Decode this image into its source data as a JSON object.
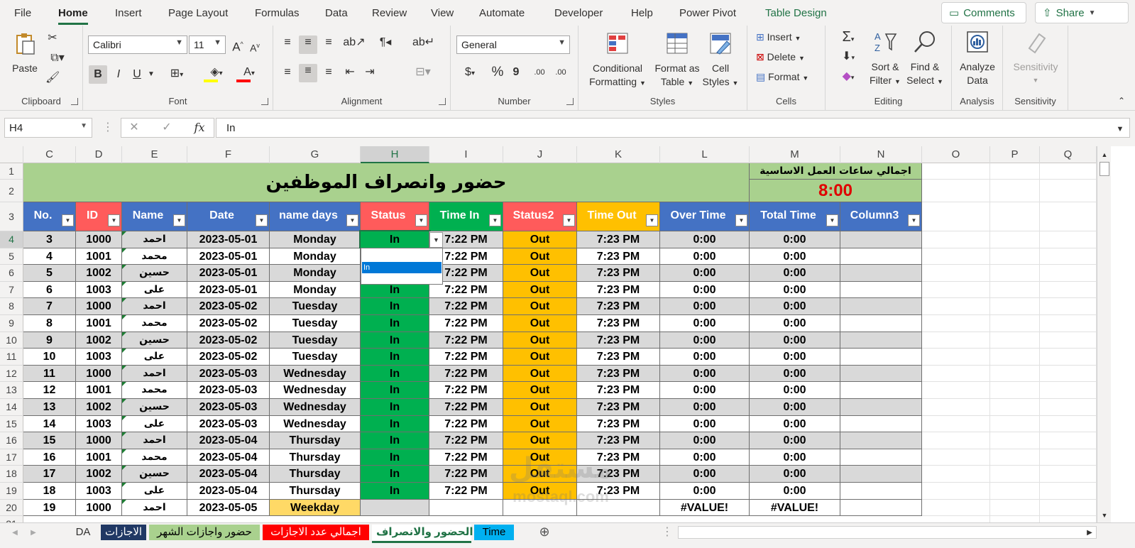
{
  "ribbon_tabs": [
    "File",
    "Home",
    "Insert",
    "Page Layout",
    "Formulas",
    "Data",
    "Review",
    "View",
    "Automate",
    "Developer",
    "Help",
    "Power Pivot",
    "Table Design"
  ],
  "active_tab": "Home",
  "top_buttons": {
    "comments": "Comments",
    "share": "Share"
  },
  "clipboard": {
    "paste": "Paste",
    "label": "Clipboard"
  },
  "font": {
    "family": "Calibri",
    "size": "11",
    "label": "Font",
    "bold": "B",
    "italic": "I",
    "underline": "U",
    "grow": "A",
    "shrink": "A",
    "fill_color": "#ffff00",
    "font_color": "#ff0000"
  },
  "alignment": {
    "label": "Alignment"
  },
  "number": {
    "format": "General",
    "label": "Number",
    "currency": "$",
    "percent": "%",
    "comma": "9"
  },
  "styles": {
    "conditional": [
      "Conditional",
      "Formatting"
    ],
    "format_table": [
      "Format as",
      "Table"
    ],
    "cell_styles": [
      "Cell",
      "Styles"
    ],
    "label": "Styles"
  },
  "cells": {
    "insert": "Insert",
    "delete": "Delete",
    "format": "Format",
    "label": "Cells"
  },
  "editing": {
    "sort": [
      "Sort &",
      "Filter"
    ],
    "find": [
      "Find &",
      "Select"
    ],
    "label": "Editing"
  },
  "analysis": {
    "analyze": [
      "Analyze",
      "Data"
    ],
    "label": "Analysis"
  },
  "sensitivity": {
    "btn": "Sensitivity",
    "label": "Sensitivity"
  },
  "formula_bar": {
    "name_box": "H4",
    "formula": "In",
    "fx": "fx"
  },
  "columns": [
    "C",
    "D",
    "E",
    "F",
    "G",
    "H",
    "I",
    "J",
    "K",
    "L",
    "M",
    "N",
    "O",
    "P",
    "Q"
  ],
  "title_main": "حضور وانصراف الموظفين",
  "hours_label": "اجمالي ساعات العمل الاساسية",
  "hours_value": "8:00",
  "headers": [
    "No.",
    "ID",
    "Name",
    "Date",
    "name days",
    "Status",
    "Time In",
    "Status2",
    "Time Out",
    "Over Time",
    "Total Time",
    "Column3"
  ],
  "rows": [
    {
      "r": "4",
      "no": "3",
      "id": "1000",
      "name": "احمد",
      "date": "2023-05-01",
      "day": "Monday",
      "status": "In",
      "tin": "7:22 PM",
      "status2": "Out",
      "tout": "7:23 PM",
      "ot": "0:00",
      "tt": "0:00"
    },
    {
      "r": "5",
      "no": "4",
      "id": "1001",
      "name": "محمد",
      "date": "2023-05-01",
      "day": "Monday",
      "status": "In",
      "tin": "7:22 PM",
      "status2": "Out",
      "tout": "7:23 PM",
      "ot": "0:00",
      "tt": "0:00"
    },
    {
      "r": "6",
      "no": "5",
      "id": "1002",
      "name": "حسين",
      "date": "2023-05-01",
      "day": "Monday",
      "status": "In",
      "tin": "7:22 PM",
      "status2": "Out",
      "tout": "7:23 PM",
      "ot": "0:00",
      "tt": "0:00"
    },
    {
      "r": "7",
      "no": "6",
      "id": "1003",
      "name": "على",
      "date": "2023-05-01",
      "day": "Monday",
      "status": "In",
      "tin": "7:22 PM",
      "status2": "Out",
      "tout": "7:23 PM",
      "ot": "0:00",
      "tt": "0:00"
    },
    {
      "r": "8",
      "no": "7",
      "id": "1000",
      "name": "احمد",
      "date": "2023-05-02",
      "day": "Tuesday",
      "status": "In",
      "tin": "7:22 PM",
      "status2": "Out",
      "tout": "7:23 PM",
      "ot": "0:00",
      "tt": "0:00"
    },
    {
      "r": "9",
      "no": "8",
      "id": "1001",
      "name": "محمد",
      "date": "2023-05-02",
      "day": "Tuesday",
      "status": "In",
      "tin": "7:22 PM",
      "status2": "Out",
      "tout": "7:23 PM",
      "ot": "0:00",
      "tt": "0:00"
    },
    {
      "r": "10",
      "no": "9",
      "id": "1002",
      "name": "حسين",
      "date": "2023-05-02",
      "day": "Tuesday",
      "status": "In",
      "tin": "7:22 PM",
      "status2": "Out",
      "tout": "7:23 PM",
      "ot": "0:00",
      "tt": "0:00"
    },
    {
      "r": "11",
      "no": "10",
      "id": "1003",
      "name": "على",
      "date": "2023-05-02",
      "day": "Tuesday",
      "status": "In",
      "tin": "7:22 PM",
      "status2": "Out",
      "tout": "7:23 PM",
      "ot": "0:00",
      "tt": "0:00"
    },
    {
      "r": "12",
      "no": "11",
      "id": "1000",
      "name": "احمد",
      "date": "2023-05-03",
      "day": "Wednesday",
      "status": "In",
      "tin": "7:22 PM",
      "status2": "Out",
      "tout": "7:23 PM",
      "ot": "0:00",
      "tt": "0:00"
    },
    {
      "r": "13",
      "no": "12",
      "id": "1001",
      "name": "محمد",
      "date": "2023-05-03",
      "day": "Wednesday",
      "status": "In",
      "tin": "7:22 PM",
      "status2": "Out",
      "tout": "7:23 PM",
      "ot": "0:00",
      "tt": "0:00"
    },
    {
      "r": "14",
      "no": "13",
      "id": "1002",
      "name": "حسين",
      "date": "2023-05-03",
      "day": "Wednesday",
      "status": "In",
      "tin": "7:22 PM",
      "status2": "Out",
      "tout": "7:23 PM",
      "ot": "0:00",
      "tt": "0:00"
    },
    {
      "r": "15",
      "no": "14",
      "id": "1003",
      "name": "على",
      "date": "2023-05-03",
      "day": "Wednesday",
      "status": "In",
      "tin": "7:22 PM",
      "status2": "Out",
      "tout": "7:23 PM",
      "ot": "0:00",
      "tt": "0:00"
    },
    {
      "r": "16",
      "no": "15",
      "id": "1000",
      "name": "احمد",
      "date": "2023-05-04",
      "day": "Thursday",
      "status": "In",
      "tin": "7:22 PM",
      "status2": "Out",
      "tout": "7:23 PM",
      "ot": "0:00",
      "tt": "0:00"
    },
    {
      "r": "17",
      "no": "16",
      "id": "1001",
      "name": "محمد",
      "date": "2023-05-04",
      "day": "Thursday",
      "status": "In",
      "tin": "7:22 PM",
      "status2": "Out",
      "tout": "7:23 PM",
      "ot": "0:00",
      "tt": "0:00"
    },
    {
      "r": "18",
      "no": "17",
      "id": "1002",
      "name": "حسين",
      "date": "2023-05-04",
      "day": "Thursday",
      "status": "In",
      "tin": "7:22 PM",
      "status2": "Out",
      "tout": "7:23 PM",
      "ot": "0:00",
      "tt": "0:00"
    },
    {
      "r": "19",
      "no": "18",
      "id": "1003",
      "name": "على",
      "date": "2023-05-04",
      "day": "Thursday",
      "status": "In",
      "tin": "7:22 PM",
      "status2": "Out",
      "tout": "7:23 PM",
      "ot": "0:00",
      "tt": "0:00"
    },
    {
      "r": "20",
      "no": "19",
      "id": "1000",
      "name": "احمد",
      "date": "2023-05-05",
      "day": "Weekday",
      "status": "",
      "tin": "",
      "status2": "",
      "tout": "",
      "ot": "#VALUE!",
      "tt": "#VALUE!"
    }
  ],
  "dropdown_option": "In",
  "sheet_tabs": [
    {
      "name": "DA",
      "color": "#f3f2f1",
      "text": "#323130"
    },
    {
      "name": "الاجازات",
      "color": "#203864",
      "text": "#ffffff"
    },
    {
      "name": "حضور واجازات الشهر",
      "color": "#a9d18e",
      "text": "#000000"
    },
    {
      "name": "اجمالي عدد الاجازات",
      "color": "#ff0000",
      "text": "#ffffff"
    },
    {
      "name": "الحضور والانصراف",
      "color": "#ffffff",
      "text": "#217346"
    },
    {
      "name": "Time",
      "color": "#00b0f0",
      "text": "#000000"
    }
  ],
  "watermark": "mostaql.com",
  "colors": {
    "title_bg": "#a9d18e",
    "blue_hdr": "#4472c4",
    "red_hdr": "#ff5b5b",
    "green": "#00b050",
    "orange": "#ffc000",
    "row_alt": "#d9d9d9",
    "accent": "#217346"
  }
}
